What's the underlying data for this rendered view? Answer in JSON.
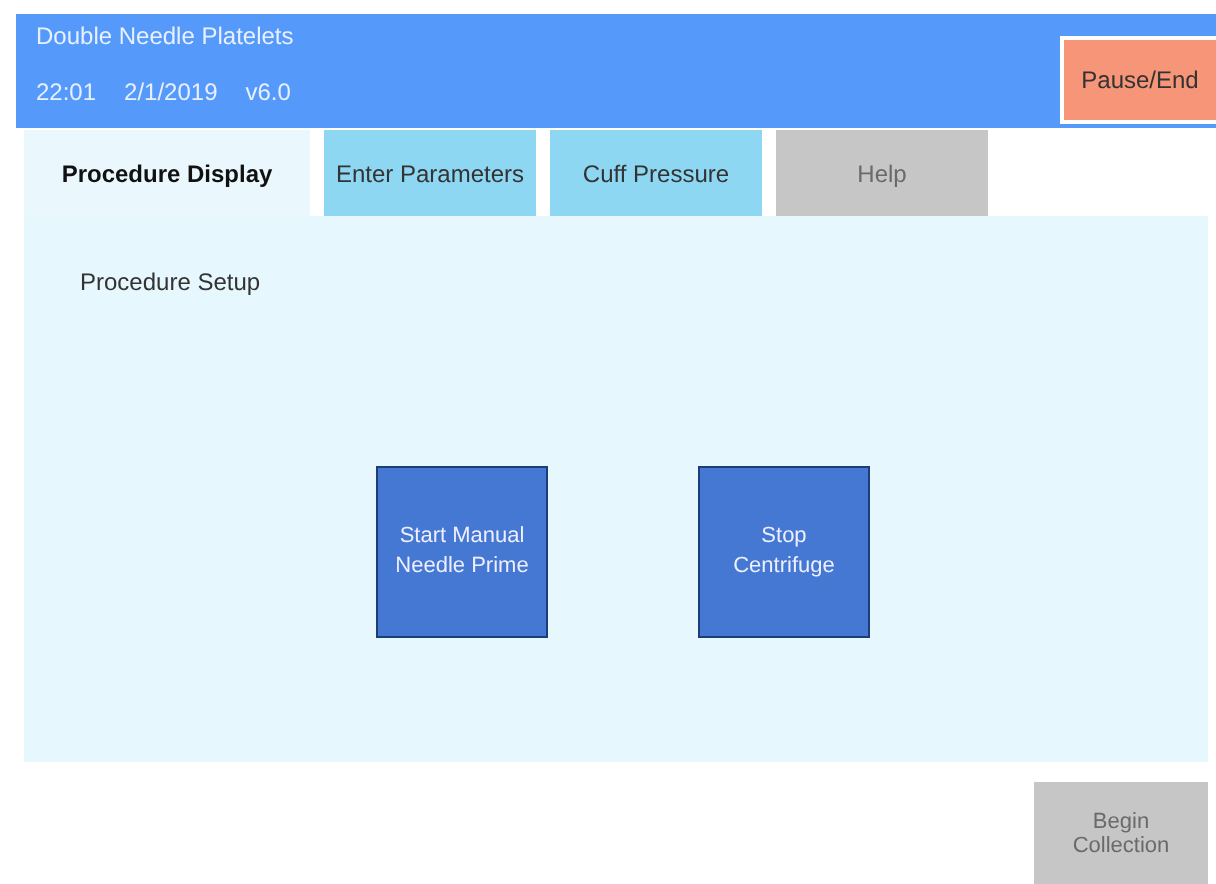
{
  "header": {
    "title": "Double Needle Platelets",
    "time": "22:01",
    "date": "2/1/2019",
    "version": "v6.0",
    "pause_button": "Pause/End"
  },
  "tabs": [
    {
      "label": "Procedure Display",
      "selected": true,
      "disabled": false
    },
    {
      "label": "Enter Parameters",
      "selected": false,
      "disabled": false
    },
    {
      "label": "Cuff Pressure",
      "selected": false,
      "disabled": false
    },
    {
      "label": "Help",
      "selected": false,
      "disabled": true
    }
  ],
  "panel": {
    "heading": "Procedure Setup",
    "actions": [
      {
        "label": "Start Manual\nNeedle Prime"
      },
      {
        "label": "Stop\nCentrifuge"
      }
    ]
  },
  "footer": {
    "button": {
      "label": "Begin\nCollection",
      "disabled": true
    }
  }
}
